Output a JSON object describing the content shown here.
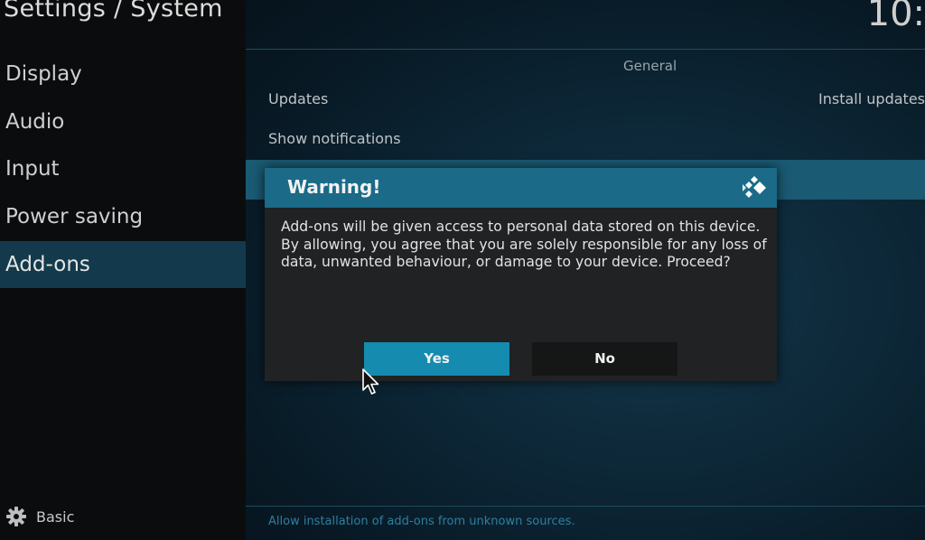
{
  "app": {
    "title": "Settings / System",
    "clock": "10:"
  },
  "sidebar": {
    "items": [
      {
        "label": "Display"
      },
      {
        "label": "Audio"
      },
      {
        "label": "Input"
      },
      {
        "label": "Power saving"
      },
      {
        "label": "Add-ons"
      }
    ],
    "active_index": 4,
    "level_label": "Basic"
  },
  "main": {
    "group_title": "General",
    "rows": [
      {
        "label": "Updates",
        "value": "Install updates"
      },
      {
        "label": "Show notifications",
        "value": ""
      }
    ],
    "hint": "Allow installation of add-ons from unknown sources."
  },
  "dialog": {
    "title": "Warning!",
    "message": "Add-ons will be given access to personal data stored on this device. By allowing, you agree that you are solely responsible for any loss of data, unwanted behaviour, or damage to your device. Proceed?",
    "yes_label": "Yes",
    "no_label": "No"
  },
  "colors": {
    "accent": "#168bb0",
    "dialog_header": "#1a6a88",
    "sidebar_active": "#133a4c"
  },
  "icons": {
    "level": "gear-icon",
    "dialog_logo": "kodi-logo-icon",
    "pointer": "mouse-pointer-icon"
  }
}
